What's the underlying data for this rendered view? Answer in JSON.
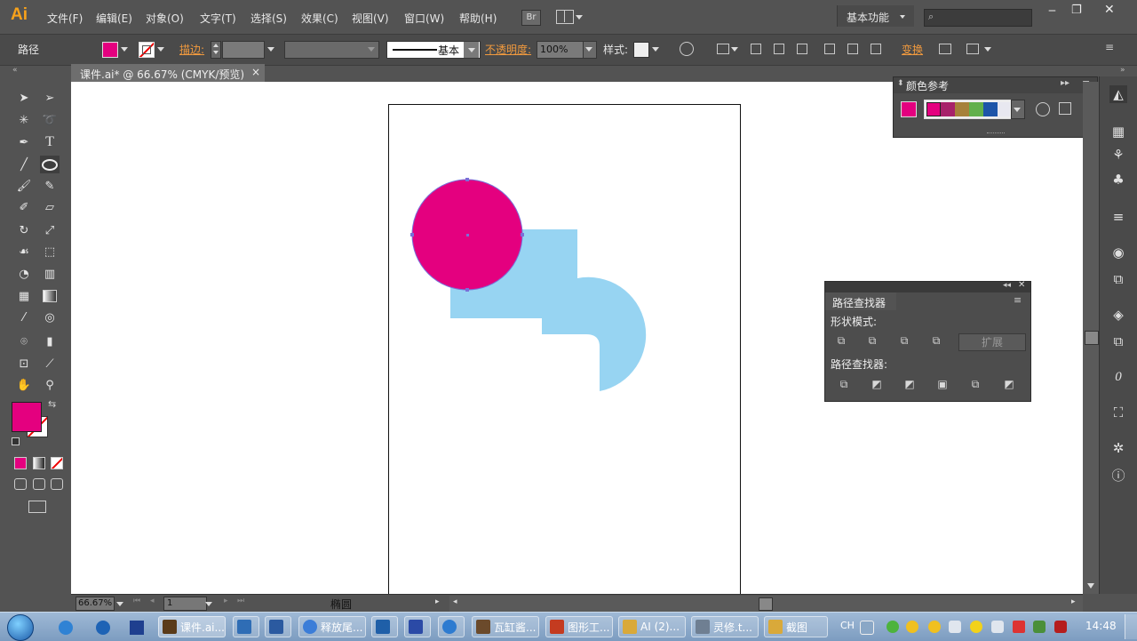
{
  "app": {
    "logo": "Ai",
    "workspace": "基本功能",
    "workspace_search_placeholder": ""
  },
  "menu": [
    {
      "label": "文件(F)"
    },
    {
      "label": "编辑(E)"
    },
    {
      "label": "对象(O)"
    },
    {
      "label": "文字(T)"
    },
    {
      "label": "选择(S)"
    },
    {
      "label": "效果(C)"
    },
    {
      "label": "视图(V)"
    },
    {
      "label": "窗口(W)"
    },
    {
      "label": "帮助(H)"
    }
  ],
  "bridge_label": "Br",
  "control": {
    "selection_type": "路径",
    "stroke_link": "描边:",
    "stroke_profile_label": "基本",
    "opacity_link": "不透明度:",
    "opacity_value": "100%",
    "style_label": "样式:",
    "transform_link": "变换"
  },
  "colors": {
    "fill": "#e4007f",
    "shape_blue": "#97d4f2",
    "accent_link": "#f19a3e"
  },
  "document": {
    "tab_title": "课件.ai* @ 66.67% (CMYK/预览)",
    "close": "×"
  },
  "tools": [
    "selection-tool",
    "direct-selection-tool",
    "magic-wand-tool",
    "lasso-tool",
    "pen-tool",
    "type-tool",
    "line-tool",
    "ellipse-tool",
    "paintbrush-tool",
    "pencil-tool",
    "blob-brush-tool",
    "eraser-tool",
    "rotate-tool",
    "scale-tool",
    "warp-tool",
    "free-transform-tool",
    "shape-builder-tool",
    "perspective-grid-tool",
    "mesh-tool",
    "gradient-tool",
    "eyedropper-tool",
    "blend-tool",
    "symbol-sprayer-tool",
    "column-graph-tool",
    "artboard-tool",
    "slice-tool",
    "hand-tool",
    "zoom-tool"
  ],
  "color_guide": {
    "title": "颜色参考",
    "swatches": [
      "#e4007f",
      "#a7226a",
      "#a6813a",
      "#62b04b",
      "#1e55a8",
      "#e8e8f0"
    ]
  },
  "pathfinder": {
    "title": "路径查找器",
    "shape_modes_label": "形状模式:",
    "expand_label": "扩展",
    "pathfinders_label": "路径查找器:"
  },
  "status": {
    "zoom": "66.67%",
    "artboard": "1",
    "current_tool": "椭圆"
  },
  "taskbar": {
    "items": [
      {
        "label": "课件.ai...",
        "color": "#5a3b1a"
      },
      {
        "label": "",
        "color": "#2f6db5"
      },
      {
        "label": "",
        "color": "#2b5aa0"
      },
      {
        "label": "释放尾...",
        "color": "#3b7dd8"
      },
      {
        "label": "",
        "color": "#1f5fa8"
      },
      {
        "label": "",
        "color": "#2b4aa6"
      },
      {
        "label": "",
        "color": "#2d7bd0"
      },
      {
        "label": "瓦缸酱...",
        "color": "#6b4a2b"
      },
      {
        "label": "图形工...",
        "color": "#c43b20"
      },
      {
        "label": "AI (2)...",
        "color": "#d9a93a"
      },
      {
        "label": "灵修.t...",
        "color": "#6f7f92"
      },
      {
        "label": "截图",
        "color": "#d9a93a"
      }
    ],
    "ime": "CH",
    "clock": "14:48"
  }
}
